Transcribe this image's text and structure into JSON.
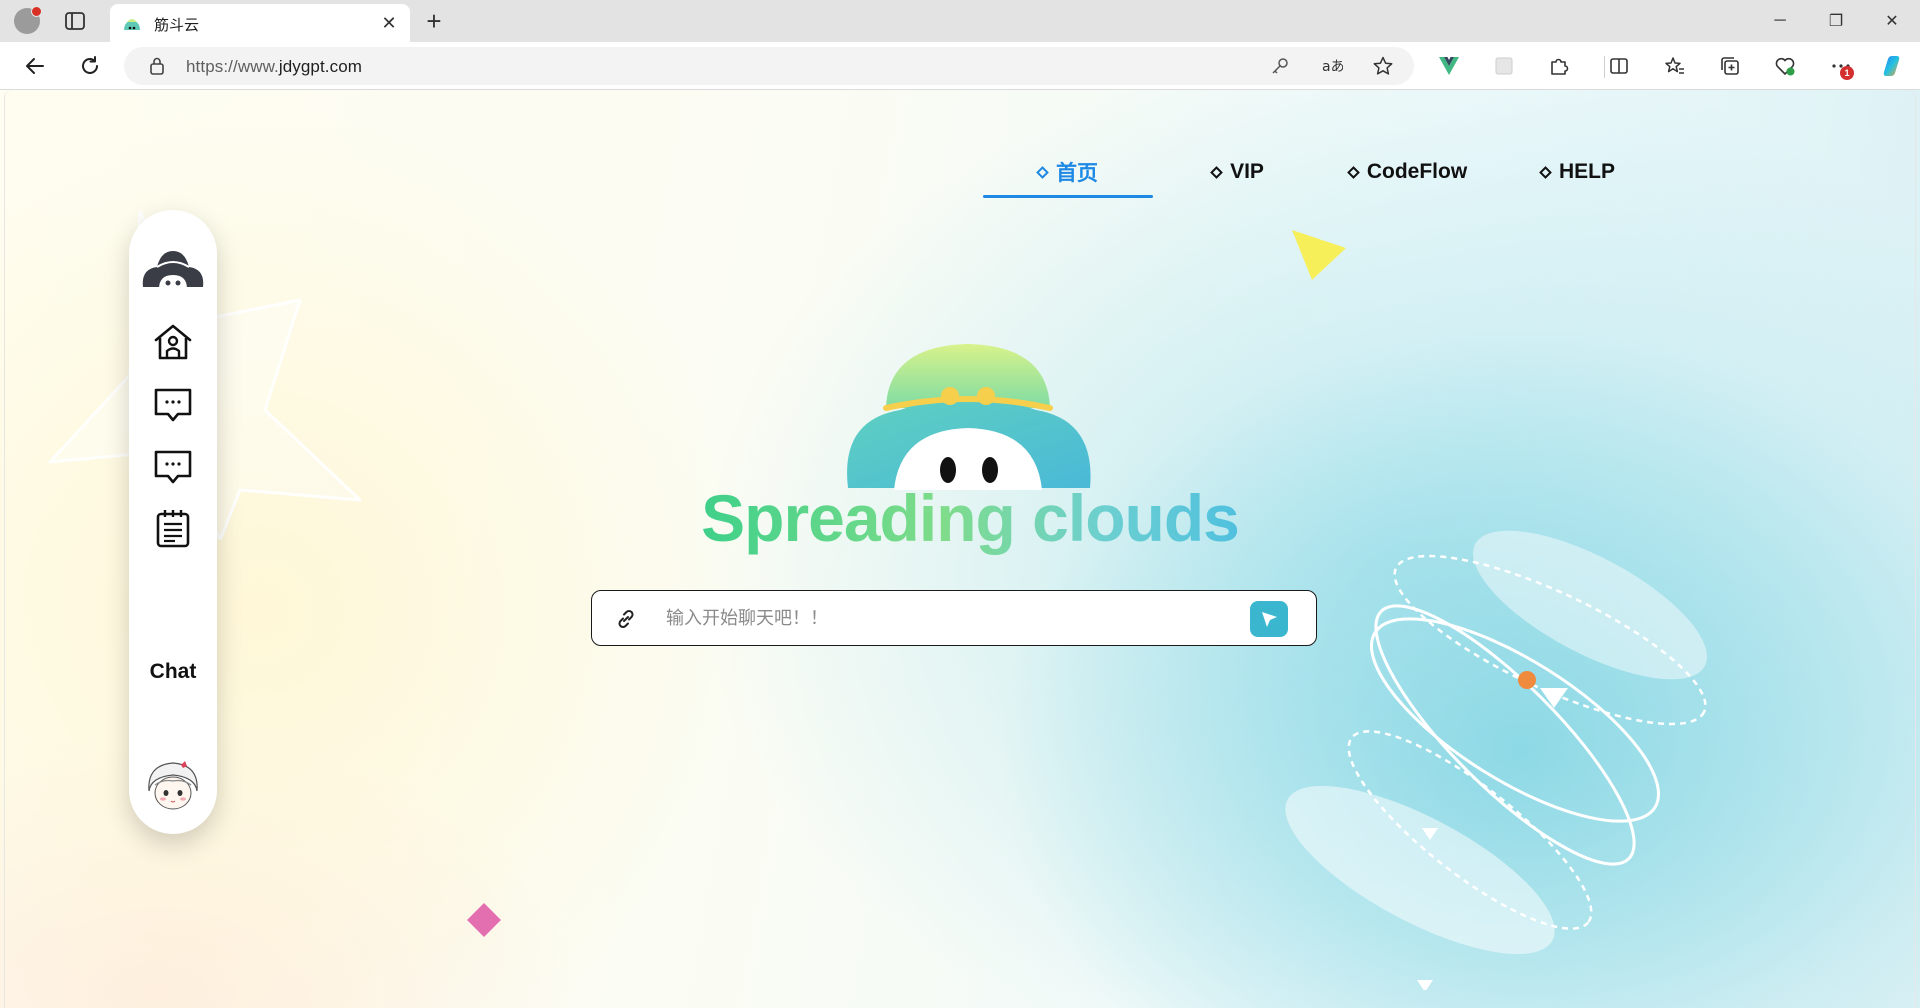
{
  "browser": {
    "tab_title": "筋斗云",
    "url_prefix": "https://www.",
    "url_host": "jdygpt.com",
    "new_tab_symbol": "+",
    "tab_close_symbol": "✕",
    "window_controls": {
      "minimize": "─",
      "maximize": "❐",
      "close": "✕"
    },
    "notification_badge": "1"
  },
  "nav": {
    "items": [
      {
        "label": "首页",
        "active": true
      },
      {
        "label": "VIP",
        "active": false
      },
      {
        "label": "CodeFlow",
        "active": false
      },
      {
        "label": "HELP",
        "active": false
      }
    ]
  },
  "sidebar": {
    "icons": [
      "cloud-logo-icon",
      "home-icon",
      "chat-icon",
      "chat-icon",
      "notes-icon"
    ],
    "label": "Chat"
  },
  "hero": {
    "title": "Spreading clouds"
  },
  "search": {
    "placeholder": "输入开始聊天吧！！"
  },
  "colors": {
    "accent": "#1e88e5",
    "send_button": "#3ab7cf",
    "title_gradient_start": "#3fd08a",
    "title_gradient_end": "#4fc0df"
  }
}
